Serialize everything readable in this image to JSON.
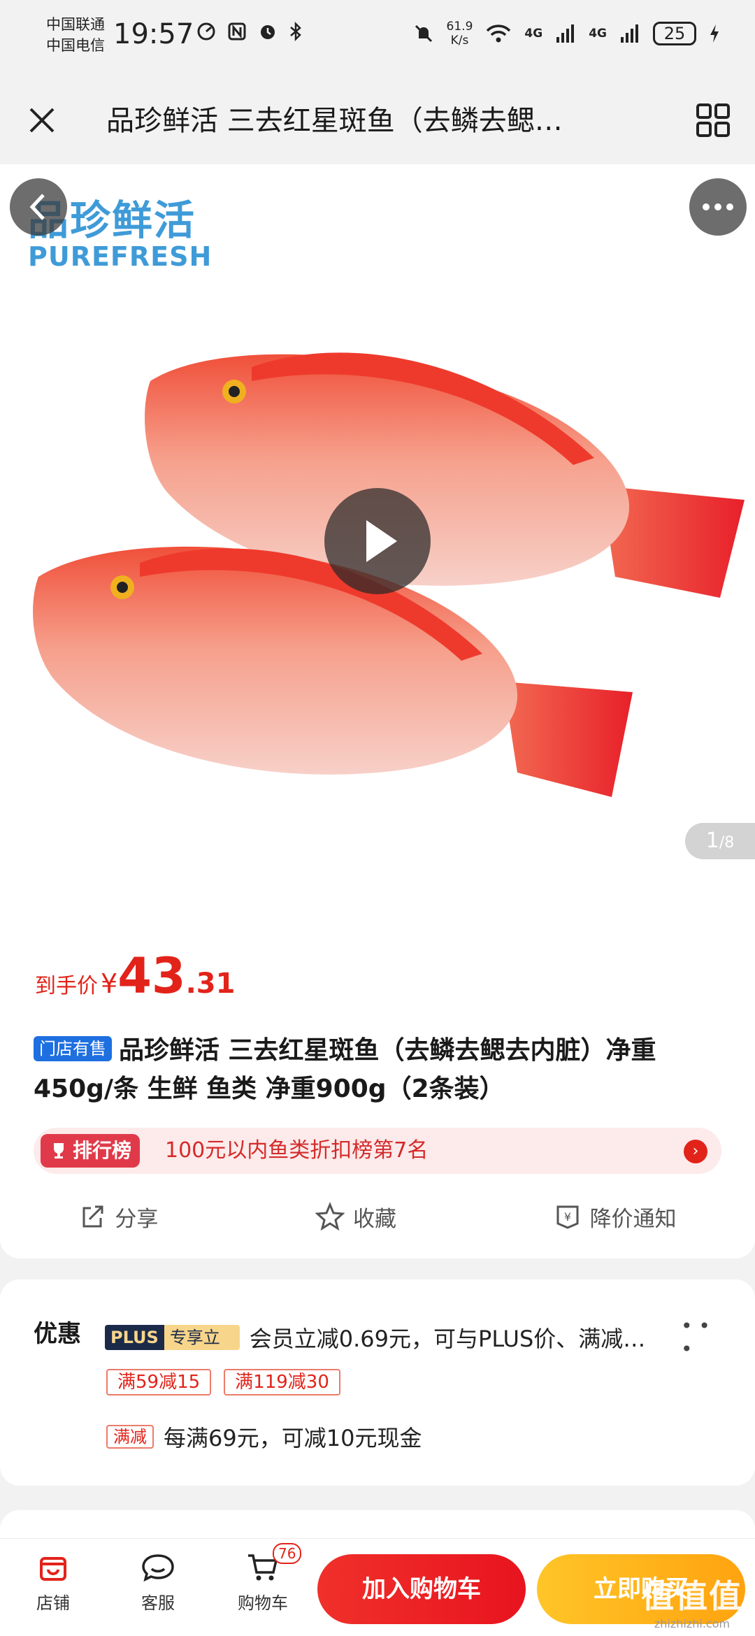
{
  "status_bar": {
    "carrier1": "中国联通",
    "carrier2": "中国电信",
    "time": "19:57",
    "net_speed_value": "61.9",
    "net_speed_unit": "K/s",
    "net1": "4G",
    "net2": "4G",
    "battery": "25"
  },
  "titlebar": {
    "title": "品珍鲜活 三去红星斑鱼（去鳞去鳃…"
  },
  "gallery": {
    "brand_cn": "品珍鲜活",
    "brand_en": "PUREFRESH",
    "page_current": "1",
    "page_total": "/8"
  },
  "price": {
    "label": "到手价",
    "symbol": "¥",
    "integer": "43",
    "decimal": ".31"
  },
  "product": {
    "store_badge": "门店有售",
    "title": "品珍鲜活 三去红星斑鱼（去鳞去鳃去内脏）净重450g/条 生鲜 鱼类 净重900g（2条装）"
  },
  "ranking": {
    "badge": "排行榜",
    "text": "100元以内鱼类折扣榜第7名"
  },
  "actions": {
    "share": "分享",
    "favorite": "收藏",
    "price_alert": "降价通知"
  },
  "promo": {
    "heading": "优惠",
    "plus_left": "PLUS",
    "plus_right": "专享立减",
    "plus_desc": "会员立减0.69元，可与PLUS价、满减…",
    "dots": "• • •",
    "coupons": [
      "满59减15",
      "满119减30"
    ],
    "manjian_tag": "满减",
    "manjian_text": "每满69元，可减10元现金"
  },
  "bottom_nav": {
    "store": "店铺",
    "service": "客服",
    "cart": "购物车",
    "cart_count": "76",
    "add_to_cart": "加入购物车",
    "buy_now": "立即购买"
  },
  "watermark": {
    "cn": "值值值",
    "en": "zhizhizhi.com"
  },
  "colors": {
    "price_red": "#e2231a",
    "brand_blue": "#3f9bd8",
    "buy_yellow": "#ffb21d"
  }
}
